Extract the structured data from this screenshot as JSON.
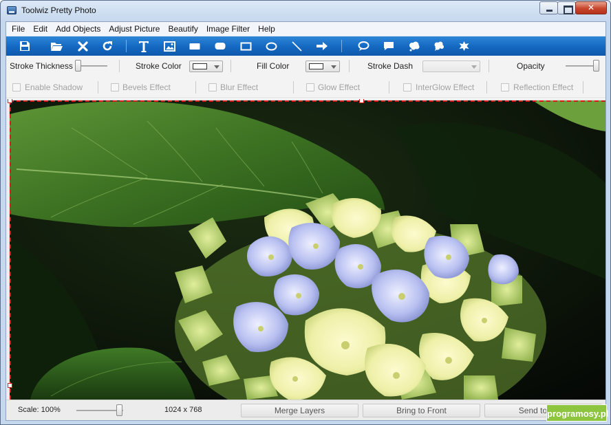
{
  "window": {
    "title": "Toolwiz Pretty Photo"
  },
  "menu": [
    "File",
    "Edit",
    "Add Objects",
    "Adjust Picture",
    "Beautify",
    "Image Filter",
    "Help"
  ],
  "toolbar": {
    "background_color": "#1467c0",
    "icons": [
      "save-icon",
      "open-folder-icon",
      "delete-icon",
      "refresh-icon",
      "text-icon",
      "image-icon",
      "rectangle-filled-icon",
      "rounded-rectangle-icon",
      "rectangle-outline-icon",
      "ellipse-icon",
      "line-icon",
      "arrow-icon",
      "speech-bubble-icon",
      "note-icon",
      "thought-bubble-icon",
      "cloud-shape-icon",
      "star-burst-icon"
    ]
  },
  "props": {
    "stroke_thickness_label": "Stroke Thickness",
    "stroke_color_label": "Stroke Color",
    "fill_color_label": "Fill Color",
    "stroke_dash_label": "Stroke Dash",
    "opacity_label": "Opacity",
    "stroke_color_value": "#ffffff",
    "fill_color_value": "#ffffff",
    "effects": [
      "Enable Shadow",
      "Bevels Effect",
      "Blur Effect",
      "Glow Effect",
      "InterGlow Effect",
      "Reflection Effect"
    ]
  },
  "status": {
    "scale_label": "Scale: 100%",
    "dimensions": "1024 x 768",
    "merge_layers": "Merge Layers",
    "bring_to_front": "Bring to Front",
    "send_to_back": "Send to Back"
  },
  "watermark": "programosy.pl",
  "selection_color": "#d81a1a"
}
